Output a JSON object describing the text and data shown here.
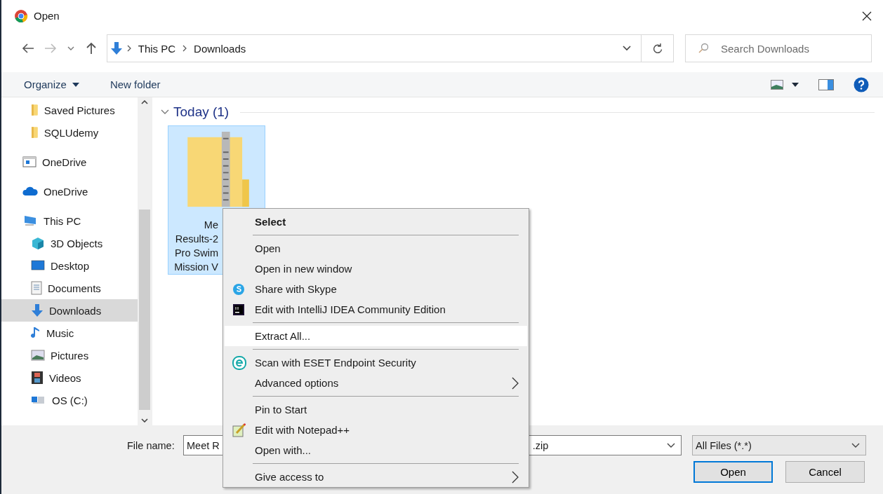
{
  "window": {
    "title": "Open"
  },
  "address": {
    "path": [
      "This PC",
      "Downloads"
    ]
  },
  "search": {
    "placeholder": "Search Downloads"
  },
  "toolbar": {
    "organize": "Organize",
    "new_folder": "New folder"
  },
  "sidebar": {
    "items": [
      {
        "children": [
          {
            "label": "Saved Pictures",
            "selected": false
          },
          {
            "label": "SQLUdemy",
            "selected": false
          }
        ]
      },
      {
        "label": "OneDrive",
        "selected": false
      },
      {
        "label": "OneDrive",
        "selected": false
      },
      {
        "label": "This PC",
        "selected": false,
        "children": [
          {
            "label": "3D Objects",
            "selected": false
          },
          {
            "label": "Desktop",
            "selected": false
          },
          {
            "label": "Documents",
            "selected": false
          },
          {
            "label": "Downloads",
            "selected": true
          },
          {
            "label": "Music",
            "selected": false
          },
          {
            "label": "Pictures",
            "selected": false
          },
          {
            "label": "Videos",
            "selected": false
          },
          {
            "label": "OS (C:)",
            "selected": false
          }
        ]
      }
    ]
  },
  "group": {
    "title": "Today (1)",
    "expanded": true
  },
  "files": [
    {
      "name_lines": [
        "Me",
        "Results-2",
        "Pro Swim",
        "Mission V"
      ],
      "selected": true
    }
  ],
  "context_menu": {
    "groups": [
      [
        {
          "label": "Select",
          "default": true,
          "highlighted": false,
          "submenu": false
        }
      ],
      [
        {
          "label": "Open",
          "default": false,
          "highlighted": false,
          "submenu": false
        },
        {
          "label": "Open in new window",
          "default": false,
          "highlighted": false,
          "submenu": false
        },
        {
          "label": "Share with Skype",
          "default": false,
          "highlighted": false,
          "submenu": false
        },
        {
          "label": "Edit with IntelliJ IDEA Community Edition",
          "default": false,
          "highlighted": false,
          "submenu": false
        }
      ],
      [
        {
          "label": "Extract All...",
          "default": false,
          "highlighted": true,
          "submenu": false
        }
      ],
      [
        {
          "label": "Scan with ESET Endpoint Security",
          "default": false,
          "highlighted": false,
          "submenu": false
        },
        {
          "label": "Advanced options",
          "default": false,
          "highlighted": false,
          "submenu": true
        }
      ],
      [
        {
          "label": "Pin to Start",
          "default": false,
          "highlighted": false,
          "submenu": false
        },
        {
          "label": "Edit with Notepad++",
          "default": false,
          "highlighted": false,
          "submenu": false
        },
        {
          "label": "Open with...",
          "default": false,
          "highlighted": false,
          "submenu": false
        }
      ],
      [
        {
          "label": "Give access to",
          "default": false,
          "highlighted": false,
          "submenu": true
        }
      ]
    ]
  },
  "footer": {
    "file_name_label": "File name:",
    "file_name_parts": [
      "Meet R",
      ".zip"
    ],
    "filter": "All Files (*.*)",
    "buttons": [
      {
        "label": "Open",
        "default": true
      },
      {
        "label": "Cancel",
        "default": false
      }
    ]
  }
}
